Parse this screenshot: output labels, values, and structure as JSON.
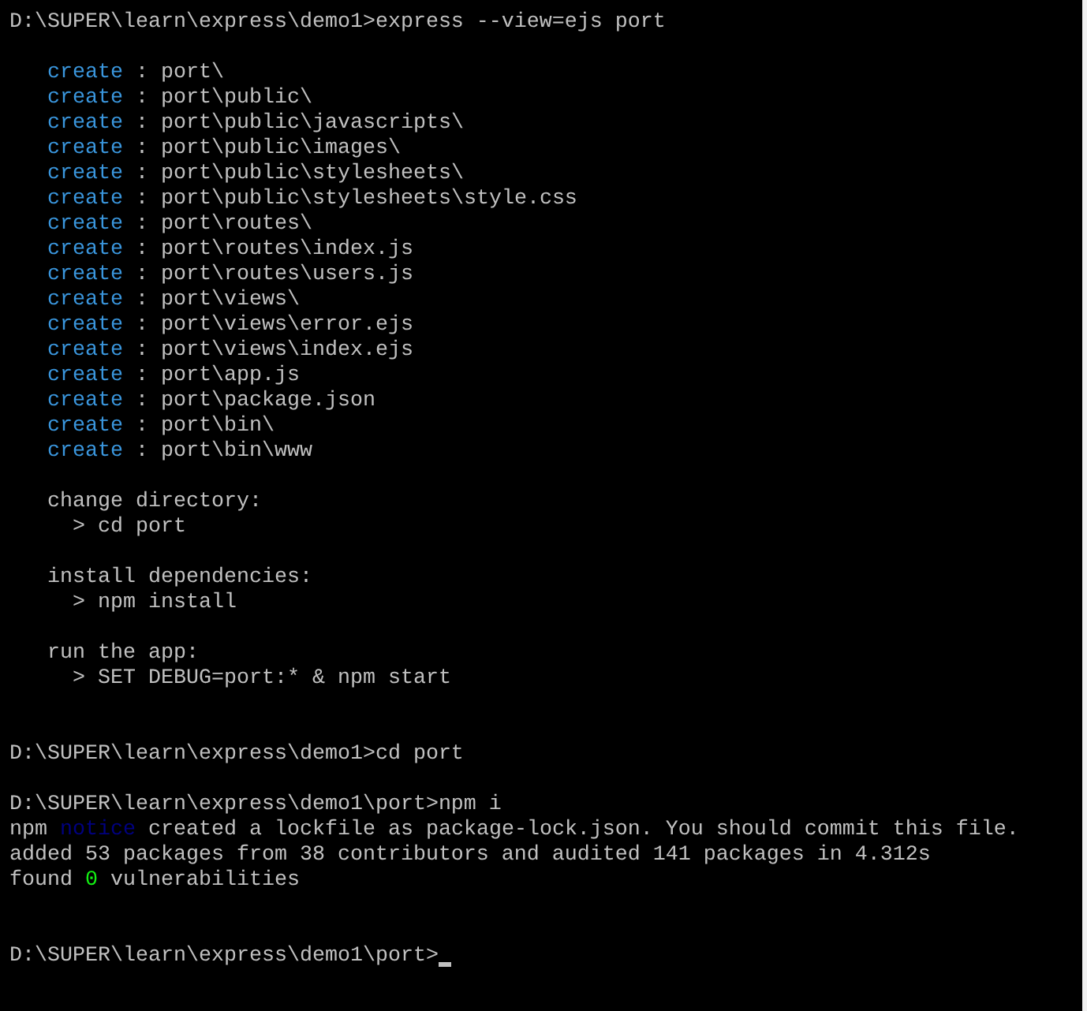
{
  "console": {
    "lines": [
      {
        "kind": "prompt",
        "segments": [
          {
            "text": "D:\\SUPER\\learn\\express\\demo1>express --view=ejs port"
          }
        ]
      },
      {
        "kind": "blank"
      },
      {
        "kind": "create",
        "segments": [
          {
            "text": "create",
            "color": "#3a96dd"
          },
          {
            "text": " : port\\"
          }
        ]
      },
      {
        "kind": "create",
        "segments": [
          {
            "text": "create",
            "color": "#3a96dd"
          },
          {
            "text": " : port\\public\\"
          }
        ]
      },
      {
        "kind": "create",
        "segments": [
          {
            "text": "create",
            "color": "#3a96dd"
          },
          {
            "text": " : port\\public\\javascripts\\"
          }
        ]
      },
      {
        "kind": "create",
        "segments": [
          {
            "text": "create",
            "color": "#3a96dd"
          },
          {
            "text": " : port\\public\\images\\"
          }
        ]
      },
      {
        "kind": "create",
        "segments": [
          {
            "text": "create",
            "color": "#3a96dd"
          },
          {
            "text": " : port\\public\\stylesheets\\"
          }
        ]
      },
      {
        "kind": "create",
        "segments": [
          {
            "text": "create",
            "color": "#3a96dd"
          },
          {
            "text": " : port\\public\\stylesheets\\style.css"
          }
        ]
      },
      {
        "kind": "create",
        "segments": [
          {
            "text": "create",
            "color": "#3a96dd"
          },
          {
            "text": " : port\\routes\\"
          }
        ]
      },
      {
        "kind": "create",
        "segments": [
          {
            "text": "create",
            "color": "#3a96dd"
          },
          {
            "text": " : port\\routes\\index.js"
          }
        ]
      },
      {
        "kind": "create",
        "segments": [
          {
            "text": "create",
            "color": "#3a96dd"
          },
          {
            "text": " : port\\routes\\users.js"
          }
        ]
      },
      {
        "kind": "create",
        "segments": [
          {
            "text": "create",
            "color": "#3a96dd"
          },
          {
            "text": " : port\\views\\"
          }
        ]
      },
      {
        "kind": "create",
        "segments": [
          {
            "text": "create",
            "color": "#3a96dd"
          },
          {
            "text": " : port\\views\\error.ejs"
          }
        ]
      },
      {
        "kind": "create",
        "segments": [
          {
            "text": "create",
            "color": "#3a96dd"
          },
          {
            "text": " : port\\views\\index.ejs"
          }
        ]
      },
      {
        "kind": "create",
        "segments": [
          {
            "text": "create",
            "color": "#3a96dd"
          },
          {
            "text": " : port\\app.js"
          }
        ]
      },
      {
        "kind": "create",
        "segments": [
          {
            "text": "create",
            "color": "#3a96dd"
          },
          {
            "text": " : port\\package.json"
          }
        ]
      },
      {
        "kind": "create",
        "segments": [
          {
            "text": "create",
            "color": "#3a96dd"
          },
          {
            "text": " : port\\bin\\"
          }
        ]
      },
      {
        "kind": "create",
        "segments": [
          {
            "text": "create",
            "color": "#3a96dd"
          },
          {
            "text": " : port\\bin\\www"
          }
        ]
      },
      {
        "kind": "blank"
      },
      {
        "kind": "heading",
        "segments": [
          {
            "text": "change directory:"
          }
        ]
      },
      {
        "kind": "command",
        "segments": [
          {
            "text": "> cd port"
          }
        ]
      },
      {
        "kind": "blank"
      },
      {
        "kind": "heading",
        "segments": [
          {
            "text": "install dependencies:"
          }
        ]
      },
      {
        "kind": "command",
        "segments": [
          {
            "text": "> npm install"
          }
        ]
      },
      {
        "kind": "blank"
      },
      {
        "kind": "heading",
        "segments": [
          {
            "text": "run the app:"
          }
        ]
      },
      {
        "kind": "command",
        "segments": [
          {
            "text": "> SET DEBUG=port:* & npm start"
          }
        ]
      },
      {
        "kind": "blank"
      },
      {
        "kind": "blank"
      },
      {
        "kind": "prompt",
        "segments": [
          {
            "text": "D:\\SUPER\\learn\\express\\demo1>cd port"
          }
        ]
      },
      {
        "kind": "blank"
      },
      {
        "kind": "prompt",
        "segments": [
          {
            "text": "D:\\SUPER\\learn\\express\\demo1\\port>npm i"
          }
        ]
      },
      {
        "kind": "output",
        "segments": [
          {
            "text": "npm "
          },
          {
            "text": "notice",
            "color": "#000080"
          },
          {
            "text": " created a lockfile as package-lock.json. You should commit this file."
          }
        ]
      },
      {
        "kind": "output",
        "segments": [
          {
            "text": "added 53 packages from 38 contributors and audited 141 packages in 4.312s"
          }
        ]
      },
      {
        "kind": "output",
        "segments": [
          {
            "text": "found "
          },
          {
            "text": "0",
            "color": "#13f013"
          },
          {
            "text": " vulnerabilities"
          }
        ]
      },
      {
        "kind": "blank"
      },
      {
        "kind": "blank"
      },
      {
        "kind": "prompt",
        "cursor": true,
        "segments": [
          {
            "text": "D:\\SUPER\\learn\\express\\demo1\\port>"
          }
        ]
      }
    ]
  }
}
